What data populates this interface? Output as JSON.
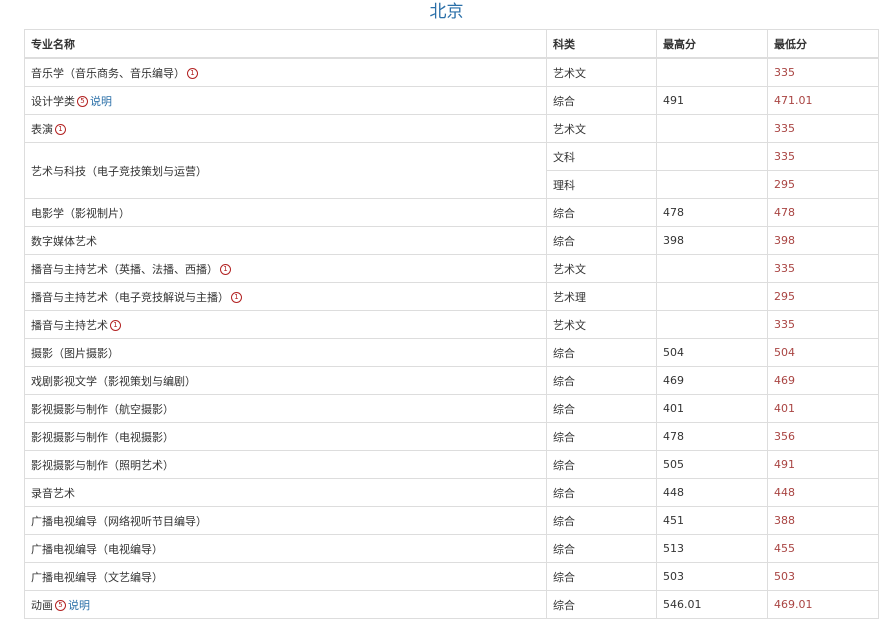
{
  "page": {
    "title": "北京"
  },
  "colors": {
    "title": "#2a6fa8",
    "min_score": "#a94442",
    "footnote": "#b22222",
    "link": "#2a6fa8",
    "border": "#dddddd"
  },
  "table": {
    "headers": [
      "专业名称",
      "科类",
      "最高分",
      "最低分"
    ],
    "rows": [
      {
        "major": "音乐学（音乐商务、音乐编导）",
        "marker": "1",
        "category": "艺术文",
        "max": "",
        "min": "335"
      },
      {
        "major": "设计学类",
        "marker": "5",
        "link": "说明",
        "category": "综合",
        "max": "491",
        "min": "471.01"
      },
      {
        "major": "表演",
        "marker": "1",
        "category": "艺术文",
        "max": "",
        "min": "335"
      },
      {
        "major": "艺术与科技（电子竞技策划与运营）",
        "rowspan": 2,
        "category": "文科",
        "max": "",
        "min": "335"
      },
      {
        "continuation": true,
        "category": "理科",
        "max": "",
        "min": "295"
      },
      {
        "major": "电影学（影视制片）",
        "category": "综合",
        "max": "478",
        "min": "478"
      },
      {
        "major": "数字媒体艺术",
        "category": "综合",
        "max": "398",
        "min": "398"
      },
      {
        "major": "播音与主持艺术（英播、法播、西播）",
        "marker": "1",
        "category": "艺术文",
        "max": "",
        "min": "335"
      },
      {
        "major": "播音与主持艺术（电子竞技解说与主播）",
        "marker": "1",
        "category": "艺术理",
        "max": "",
        "min": "295"
      },
      {
        "major": "播音与主持艺术",
        "marker": "1",
        "category": "艺术文",
        "max": "",
        "min": "335"
      },
      {
        "major": "摄影（图片摄影）",
        "category": "综合",
        "max": "504",
        "min": "504"
      },
      {
        "major": "戏剧影视文学（影视策划与编剧）",
        "category": "综合",
        "max": "469",
        "min": "469"
      },
      {
        "major": "影视摄影与制作（航空摄影）",
        "category": "综合",
        "max": "401",
        "min": "401"
      },
      {
        "major": "影视摄影与制作（电视摄影）",
        "category": "综合",
        "max": "478",
        "min": "356"
      },
      {
        "major": "影视摄影与制作（照明艺术）",
        "category": "综合",
        "max": "505",
        "min": "491"
      },
      {
        "major": "录音艺术",
        "category": "综合",
        "max": "448",
        "min": "448"
      },
      {
        "major": "广播电视编导（网络视听节目编导）",
        "category": "综合",
        "max": "451",
        "min": "388"
      },
      {
        "major": "广播电视编导（电视编导）",
        "category": "综合",
        "max": "513",
        "min": "455"
      },
      {
        "major": "广播电视编导（文艺编导）",
        "category": "综合",
        "max": "503",
        "min": "503"
      },
      {
        "major": "动画",
        "marker": "5",
        "link": "说明",
        "category": "综合",
        "max": "546.01",
        "min": "469.01"
      }
    ]
  }
}
